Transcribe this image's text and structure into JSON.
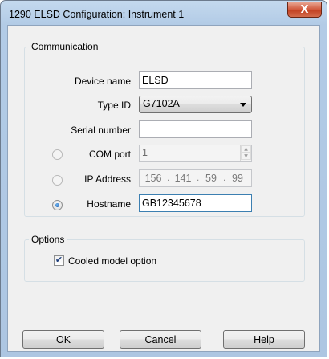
{
  "window": {
    "title": "1290 ELSD Configuration: Instrument 1",
    "close_glyph": "X"
  },
  "communication": {
    "legend": "Communication",
    "device_name_label": "Device name",
    "device_name_value": "ELSD",
    "type_id_label": "Type ID",
    "type_id_value": "G7102A",
    "serial_number_label": "Serial number",
    "serial_number_value": "",
    "com_port_label": "COM port",
    "com_port_value": "1",
    "ip_address_label": "IP Address",
    "ip_address": [
      "156",
      "141",
      "59",
      "99"
    ],
    "hostname_label": "Hostname",
    "hostname_value": "GB12345678",
    "selected_connection": "hostname"
  },
  "options": {
    "legend": "Options",
    "cooled_model_label": "Cooled model option",
    "cooled_model_checked": true,
    "check_glyph": "✔"
  },
  "buttons": {
    "ok": "OK",
    "cancel": "Cancel",
    "help": "Help"
  },
  "colors": {
    "title_bar": "#b9d1ea",
    "close_button": "#c7482a",
    "dialog_background": "#f0f0f0"
  }
}
